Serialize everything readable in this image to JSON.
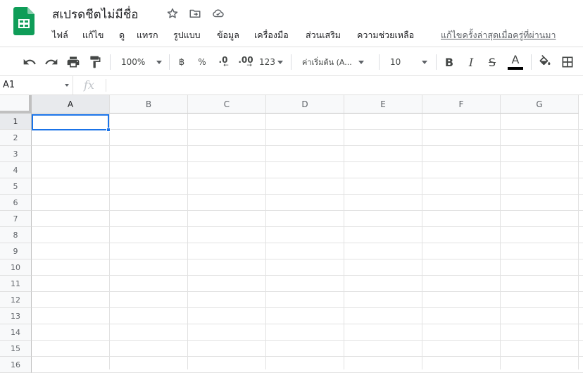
{
  "doc": {
    "title": "สเปรดชีตไม่มีชื่อ",
    "icons": [
      "star-icon",
      "move-to-folder-icon",
      "cloud-status-icon"
    ]
  },
  "menu": {
    "file": "ไฟล์",
    "edit": "แก้ไข",
    "view": "ดู",
    "insert": "แทรก",
    "format": "รูปแบบ",
    "data": "ข้อมูล",
    "tools": "เครื่องมือ",
    "addons": "ส่วนเสริม",
    "help": "ความช่วยเหลือ",
    "last_edit": "แก้ไขครั้งล่าสุดเมื่อครู่ที่ผ่านมา"
  },
  "toolbar": {
    "zoom": "100%",
    "currency": "฿",
    "percent": "%",
    "decrease_decimal": ".0",
    "increase_decimal": ".00",
    "more_formats": "123",
    "font": "ค่าเริ่มต้น (A...",
    "font_size": "10",
    "bold": "B",
    "italic": "I",
    "strike": "S",
    "text_color": "A",
    "text_color_value": "#000000"
  },
  "formula": {
    "cell_ref": "A1",
    "fx": "fx",
    "value": ""
  },
  "grid": {
    "columns": [
      "A",
      "B",
      "C",
      "D",
      "E",
      "F",
      "G"
    ],
    "rows": [
      "1",
      "2",
      "3",
      "4",
      "5",
      "6",
      "7",
      "8",
      "9",
      "10",
      "11",
      "12",
      "13",
      "14",
      "15",
      "16"
    ],
    "selected_cell": "A1",
    "selection_color": "#1a73e8"
  },
  "colors": {
    "brand": "#0f9d58",
    "accent": "#1a73e8"
  }
}
